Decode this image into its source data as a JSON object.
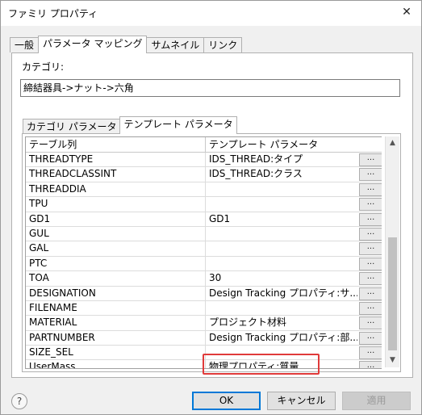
{
  "window": {
    "title": "ファミリ プロパティ",
    "close_glyph": "✕"
  },
  "tabs": [
    {
      "label": "一般",
      "active": false
    },
    {
      "label": "パラメータ マッピング",
      "active": true
    },
    {
      "label": "サムネイル",
      "active": false
    },
    {
      "label": "リンク",
      "active": false
    }
  ],
  "category": {
    "label": "カテゴリ:",
    "value": "締結器具->ナット->六角"
  },
  "subtabs": [
    {
      "label": "カテゴリ パラメータ",
      "active": false
    },
    {
      "label": "テンプレート パラメータ",
      "active": true
    }
  ],
  "grid": {
    "headers": [
      "テーブル列",
      "テンプレート パラメータ"
    ],
    "ellipsis_label": "...",
    "rows": [
      {
        "col": "THREADTYPE",
        "param": "IDS_THREAD:タイプ"
      },
      {
        "col": "THREADCLASSINT",
        "param": "IDS_THREAD:クラス"
      },
      {
        "col": "THREADDIA",
        "param": ""
      },
      {
        "col": "TPU",
        "param": ""
      },
      {
        "col": "GD1",
        "param": "GD1"
      },
      {
        "col": "GUL",
        "param": ""
      },
      {
        "col": "GAL",
        "param": ""
      },
      {
        "col": "PTC",
        "param": ""
      },
      {
        "col": "TOA",
        "param": "30"
      },
      {
        "col": "DESIGNATION",
        "param": "Design Tracking プロパティ:サ..."
      },
      {
        "col": "FILENAME",
        "param": ""
      },
      {
        "col": "MATERIAL",
        "param": "プロジェクト材料"
      },
      {
        "col": "PARTNUMBER",
        "param": "Design Tracking プロパティ:部..."
      },
      {
        "col": "SIZE_SEL",
        "param": ""
      },
      {
        "col": "UserMass",
        "param": "物理プロパティ:質量"
      }
    ]
  },
  "highlight_color": "#e03a3a",
  "buttons": {
    "help": "?",
    "ok": "OK",
    "cancel": "キャンセル",
    "apply": "適用"
  },
  "scroll": {
    "up": "▲",
    "down": "▼"
  }
}
